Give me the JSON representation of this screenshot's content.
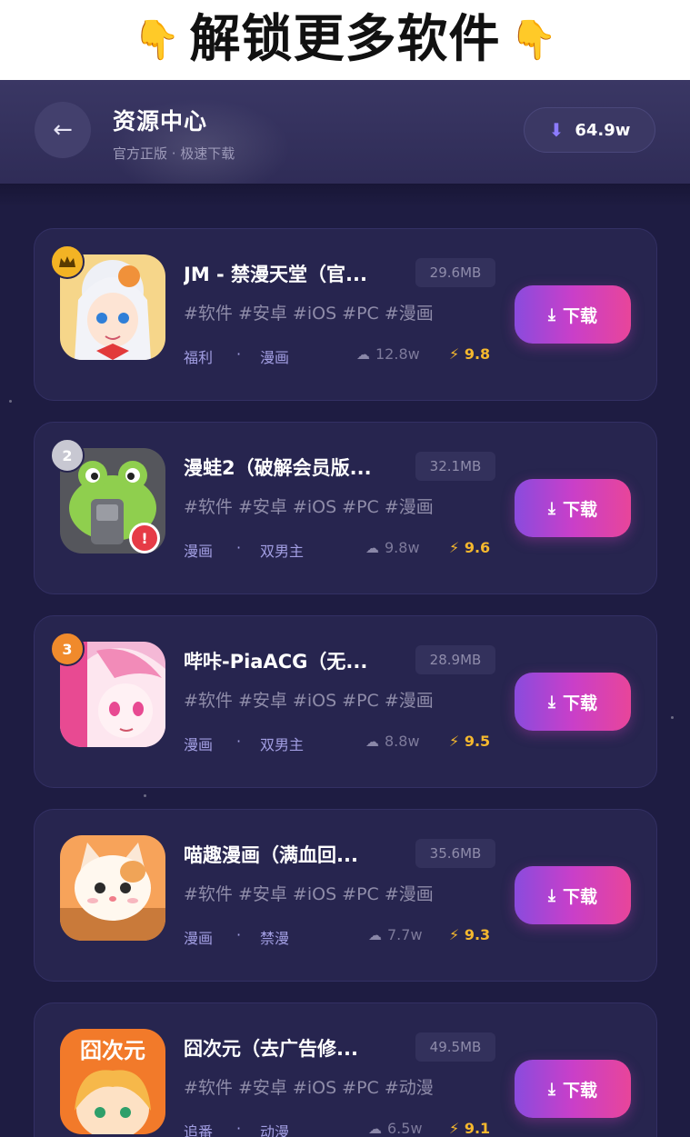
{
  "banner": {
    "text": "解锁更多软件",
    "left_icon": "pointing-down-hand-icon",
    "right_icon": "pointing-down-hand-icon"
  },
  "header": {
    "title": "资源中心",
    "subtitle": "官方正版 · 极速下载",
    "download_count": "64.9w"
  },
  "colors": {
    "background": "#1e1c42",
    "card": "#27254f",
    "accent_gradient_start": "#8a4bdd",
    "accent_gradient_end": "#e8459a",
    "rating": "#f5b82e"
  },
  "items": [
    {
      "name": "JM - 禁漫天堂（官...",
      "size": "29.6MB",
      "tags": "#软件 #安卓 #iOS #PC #漫画",
      "category1": "福利",
      "category2": "漫画",
      "downloads": "12.8w",
      "rating": "9.8",
      "rank": "crown-icon",
      "button": "下载"
    },
    {
      "name": "漫蛙2（破解会员版...",
      "size": "32.1MB",
      "tags": "#软件 #安卓 #iOS #PC #漫画",
      "category1": "漫画",
      "category2": "双男主",
      "downloads": "9.8w",
      "rating": "9.6",
      "rank": "2",
      "button": "下载"
    },
    {
      "name": "哔咔-PiaACG（无...",
      "size": "28.9MB",
      "tags": "#软件 #安卓 #iOS #PC #漫画",
      "category1": "漫画",
      "category2": "双男主",
      "downloads": "8.8w",
      "rating": "9.5",
      "rank": "3",
      "button": "下载"
    },
    {
      "name": "喵趣漫画（满血回...",
      "size": "35.6MB",
      "tags": "#软件 #安卓 #iOS #PC #漫画",
      "category1": "漫画",
      "category2": "禁漫",
      "downloads": "7.7w",
      "rating": "9.3",
      "button": "下载"
    },
    {
      "name": "囧次元（去广告修...",
      "size": "49.5MB",
      "tags": "#软件 #安卓 #iOS #PC #动漫",
      "category1": "追番",
      "category2": "动漫",
      "downloads": "6.5w",
      "rating": "9.1",
      "icon_text": "囧次元",
      "button": "下载"
    }
  ]
}
